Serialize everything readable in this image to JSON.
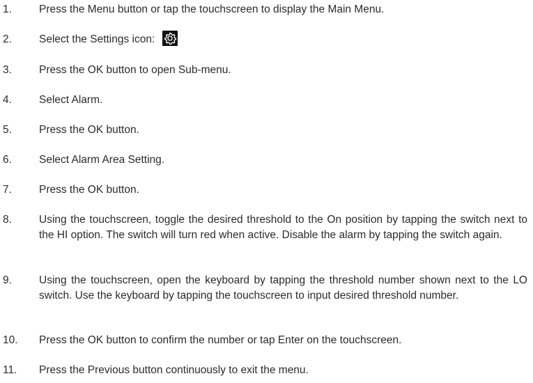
{
  "steps": [
    {
      "num": "1.",
      "text": "Press the Menu button or tap the touchscreen to display the Main Menu."
    },
    {
      "num": "2.",
      "text": "Select the Settings icon:",
      "icon": "gear-icon"
    },
    {
      "num": "3.",
      "text": "Press the OK button to open Sub-menu."
    },
    {
      "num": "4.",
      "text": "Select Alarm."
    },
    {
      "num": "5.",
      "text": "Press the OK button."
    },
    {
      "num": "6.",
      "text": "Select Alarm Area Setting."
    },
    {
      "num": "7.",
      "text": "Press the OK button."
    },
    {
      "num": "8.",
      "text": "Using the touchscreen, toggle the desired threshold to the On position by tapping the switch next to the HI option. The switch will turn red when active. Disable the alarm by tapping the switch again."
    },
    {
      "num": "9.",
      "text": "Using the touchscreen, open the keyboard by tapping the threshold number shown next to the LO switch. Use the keyboard by tapping the touchscreen to input desired  threshold number."
    },
    {
      "num": "10.",
      "text": "Press the OK button to confirm the number or tap Enter on the touchscreen."
    },
    {
      "num": "11.",
      "text": "Press the Previous button continuously to exit the menu."
    }
  ]
}
